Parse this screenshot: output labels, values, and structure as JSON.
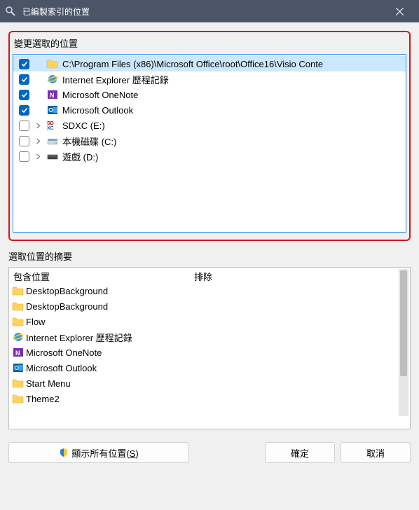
{
  "window": {
    "title": "已編製索引的位置"
  },
  "top_group": {
    "label": "變更選取的位置",
    "items": [
      {
        "checked": true,
        "expandable": false,
        "icon": "folder",
        "label": "C:\\Program Files (x86)\\Microsoft Office\\root\\Office16\\Visio Conte",
        "selected": true
      },
      {
        "checked": true,
        "expandable": false,
        "icon": "ie",
        "label": "Internet Explorer 歷程記錄",
        "selected": false
      },
      {
        "checked": true,
        "expandable": false,
        "icon": "onenote",
        "label": "Microsoft OneNote",
        "selected": false
      },
      {
        "checked": true,
        "expandable": false,
        "icon": "outlook",
        "label": "Microsoft Outlook",
        "selected": false
      },
      {
        "checked": false,
        "expandable": true,
        "icon": "sdxc",
        "label": "SDXC (E:)",
        "selected": false
      },
      {
        "checked": false,
        "expandable": true,
        "icon": "drive",
        "label": "本機磁碟 (C:)",
        "selected": false
      },
      {
        "checked": false,
        "expandable": true,
        "icon": "drive2",
        "label": "遊戲 (D:)",
        "selected": false
      }
    ]
  },
  "bottom_group": {
    "label": "選取位置的摘要",
    "col_included": "包含位置",
    "col_excluded": "排除",
    "items": [
      {
        "icon": "folder",
        "label": "DesktopBackground"
      },
      {
        "icon": "folder",
        "label": "DesktopBackground"
      },
      {
        "icon": "folder",
        "label": "Flow"
      },
      {
        "icon": "ie",
        "label": "Internet Explorer 歷程記錄"
      },
      {
        "icon": "onenote",
        "label": "Microsoft OneNote"
      },
      {
        "icon": "outlook",
        "label": "Microsoft Outlook"
      },
      {
        "icon": "folder",
        "label": "Start Menu"
      },
      {
        "icon": "folder",
        "label": "Theme2"
      }
    ]
  },
  "buttons": {
    "show_all": "顯示所有位置(",
    "show_all_key": "S",
    "show_all_suffix": ")",
    "ok": "確定",
    "cancel": "取消"
  }
}
